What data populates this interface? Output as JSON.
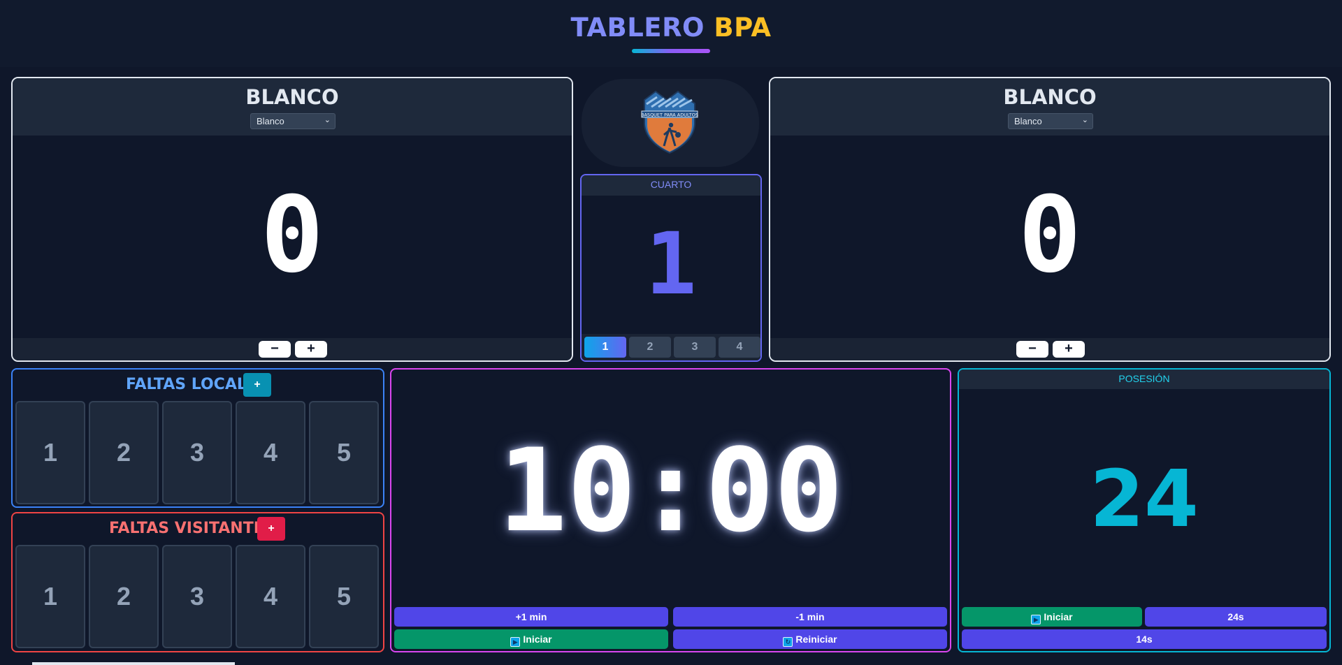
{
  "header": {
    "title_part1": "TABLERO",
    "title_part2": "BPA"
  },
  "home": {
    "name": "BLANCO",
    "color_select": "Blanco",
    "score": "0",
    "minus_label": "−",
    "plus_label": "+"
  },
  "away": {
    "name": "BLANCO",
    "color_select": "Blanco",
    "score": "0",
    "minus_label": "−",
    "plus_label": "+"
  },
  "logo": {
    "text": "BASQUET PARA ADULTOS"
  },
  "quarter": {
    "label": "CUARTO",
    "value": "1",
    "buttons": [
      "1",
      "2",
      "3",
      "4"
    ],
    "active": "1"
  },
  "fouls_local": {
    "title": "FALTAS LOCAL",
    "add_label": "+",
    "boxes": [
      "1",
      "2",
      "3",
      "4",
      "5"
    ]
  },
  "fouls_visit": {
    "title": "FALTAS VISITANTE",
    "add_label": "+",
    "boxes": [
      "1",
      "2",
      "3",
      "4",
      "5"
    ]
  },
  "clock": {
    "time": "10:00",
    "plus_min": "+1 min",
    "minus_min": "-1 min",
    "start": "Iniciar",
    "reset": "Reiniciar"
  },
  "possession": {
    "label": "POSESIÓN",
    "value": "24",
    "start": "Iniciar",
    "reset24": "24s",
    "reset14": "14s"
  },
  "colors": {
    "accent_indigo": "#6366f1",
    "local_blue": "#3b82f6",
    "visit_red": "#ef4444",
    "clock_magenta": "#d946ef",
    "possession_cyan": "#06b6d4",
    "title_gold": "#fbbf24",
    "start_green": "#059669"
  }
}
